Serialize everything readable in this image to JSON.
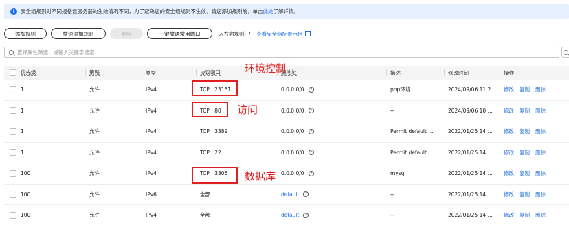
{
  "notice": {
    "text": "安全组规则对不同规格云服务器的生效情况不同，为了避免您的安全组规则不生效，请您添加规则前，单击",
    "link": "此处",
    "suffix": "了解详情。"
  },
  "toolbar": {
    "add_rule": "添加规则",
    "quick_add": "快速添加规则",
    "delete": "删除",
    "open_ports": "一键放通常用端口",
    "inbound_count": "入方向规则: 7",
    "example_link": "查看安全组配置示例"
  },
  "search": {
    "placeholder": "选择属性筛选，或输入关键字搜索"
  },
  "table": {
    "headers": {
      "priority": "优先级",
      "policy": "策略",
      "type": "类型",
      "protocol_port": "协议端口",
      "source": "源地址",
      "description": "描述",
      "modified": "修改时间",
      "actions": "操作"
    },
    "actions": {
      "edit": "修改",
      "copy": "复制",
      "delete": "删除"
    },
    "rows": [
      {
        "priority": "1",
        "policy": "允许",
        "type": "IPv4",
        "port": "TCP : 23161",
        "source": "0.0.0.0/0",
        "source_link": false,
        "description": "php环境",
        "modified": "2024/09/06 11:2..."
      },
      {
        "priority": "1",
        "policy": "允许",
        "type": "IPv4",
        "port": "TCP : 80",
        "source": "0.0.0.0/0",
        "source_link": false,
        "description": "--",
        "modified": "2024/09/06 10:..."
      },
      {
        "priority": "1",
        "policy": "允许",
        "type": "IPv4",
        "port": "TCP : 3389",
        "source": "0.0.0.0/0",
        "source_link": false,
        "description": "Permit default ...",
        "modified": "2022/01/25 14:..."
      },
      {
        "priority": "1",
        "policy": "允许",
        "type": "IPv4",
        "port": "TCP : 22",
        "source": "0.0.0.0/0",
        "source_link": false,
        "description": "Permit default L...",
        "modified": "2022/01/25 14:..."
      },
      {
        "priority": "100",
        "policy": "允许",
        "type": "IPv4",
        "port": "TCP : 3306",
        "source": "0.0.0.0/0",
        "source_link": false,
        "description": "mysql",
        "modified": "2022/01/25 14:..."
      },
      {
        "priority": "100",
        "policy": "允许",
        "type": "IPv6",
        "port": "全部",
        "source": "default",
        "source_link": true,
        "description": "--",
        "modified": "2022/01/25 14:..."
      },
      {
        "priority": "100",
        "policy": "允许",
        "type": "IPv4",
        "port": "全部",
        "source": "default",
        "source_link": true,
        "description": "--",
        "modified": "2022/01/25 14:..."
      }
    ]
  },
  "annotations": {
    "env_control": "环境控制",
    "access": "访问",
    "database": "数据库"
  },
  "colors": {
    "accent": "#1f6fe5",
    "annotation": "#e02020",
    "notice_bg": "#e6f0ff"
  }
}
